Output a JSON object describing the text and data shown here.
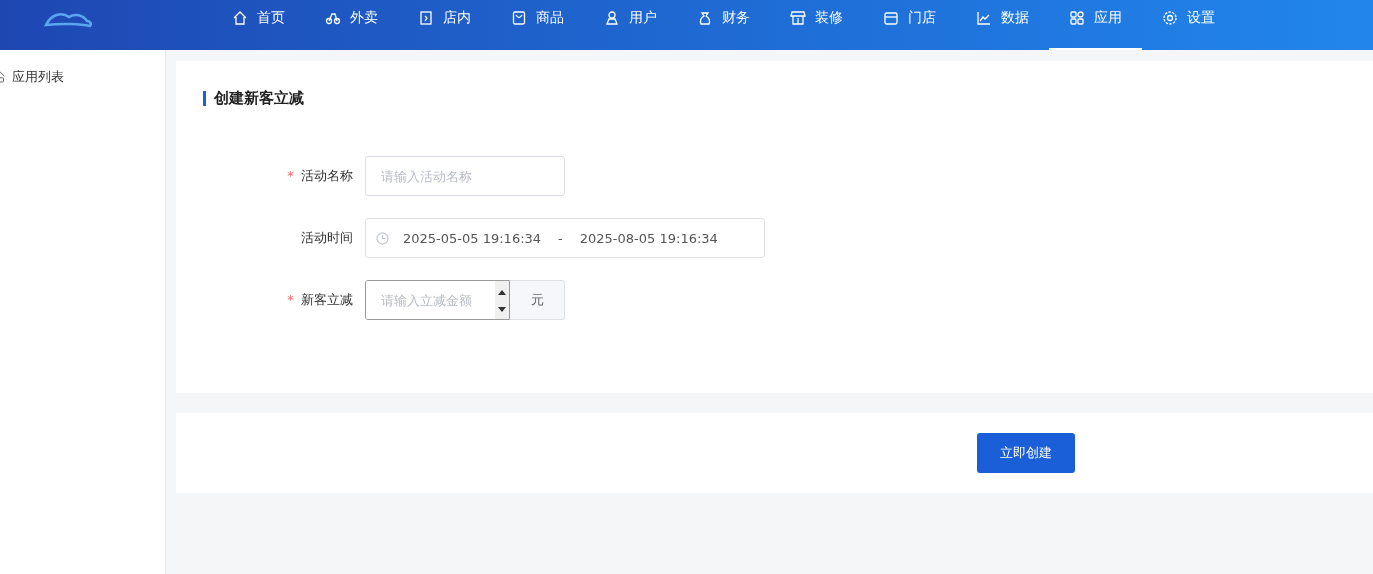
{
  "nav": [
    {
      "label": "首页",
      "selected": false
    },
    {
      "label": "外卖",
      "selected": false
    },
    {
      "label": "店内",
      "selected": false
    },
    {
      "label": "商品",
      "selected": false
    },
    {
      "label": "用户",
      "selected": false
    },
    {
      "label": "财务",
      "selected": false
    },
    {
      "label": "装修",
      "selected": false
    },
    {
      "label": "门店",
      "selected": false
    },
    {
      "label": "数据",
      "selected": false
    },
    {
      "label": "应用",
      "selected": true
    },
    {
      "label": "设置",
      "selected": false
    }
  ],
  "sidebar": {
    "items": [
      {
        "label": "应用列表"
      }
    ]
  },
  "form": {
    "title": "创建新客立减",
    "fields": [
      {
        "kind": "text",
        "mark": "*",
        "label": "活动名称",
        "placeholder": "请输入活动名称"
      },
      {
        "kind": "daterange",
        "label": "活动时间",
        "start": "2025-05-05 19:16:34",
        "separator": "-",
        "end": "2025-08-05 19:16:34"
      },
      {
        "kind": "number",
        "mark": "*",
        "label": "新客立减",
        "placeholder": "请输入立减金额",
        "unit": "元"
      }
    ]
  },
  "submit": {
    "label": "立即创建"
  }
}
